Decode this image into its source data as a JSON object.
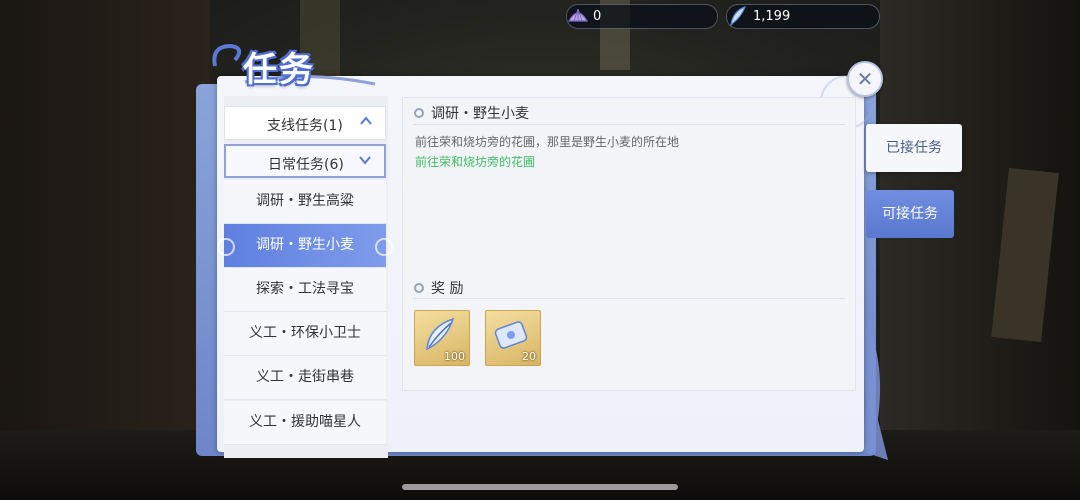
{
  "currency": {
    "shell": {
      "icon": "shell-icon",
      "value": "0"
    },
    "feather": {
      "icon": "feather-icon",
      "value": "1,199"
    }
  },
  "window": {
    "title": "任务",
    "close_icon": "close-icon"
  },
  "categories": [
    {
      "label": "支线任务(1)",
      "icon": "chevron-up-icon"
    },
    {
      "label": "日常任务(6)",
      "icon": "chevron-down-icon"
    }
  ],
  "tasks": [
    {
      "label": "调研・野生高粱",
      "active": false
    },
    {
      "label": "调研・野生小麦",
      "active": true
    },
    {
      "label": "探索・工法寻宝",
      "active": false
    },
    {
      "label": "义工・环保小卫士",
      "active": false
    },
    {
      "label": "义工・走街串巷",
      "active": false
    },
    {
      "label": "义工・援助喵星人",
      "active": false
    }
  ],
  "detail": {
    "title": "调研・野生小麦",
    "description": "前往荣和烧坊旁的花圃，那里是野生小麦的所在地",
    "objective": "前往荣和烧坊旁的花圃",
    "reward_title": "奖 励",
    "rewards": [
      {
        "icon": "feather-icon",
        "qty": "100"
      },
      {
        "icon": "ticket-icon",
        "qty": "20"
      }
    ]
  },
  "tabs": {
    "accepted": "已接任务",
    "available": "可接任务"
  },
  "colors": {
    "accent": "#5e7fe0",
    "objective": "#3ebd63",
    "frame": "#7a92d2"
  }
}
